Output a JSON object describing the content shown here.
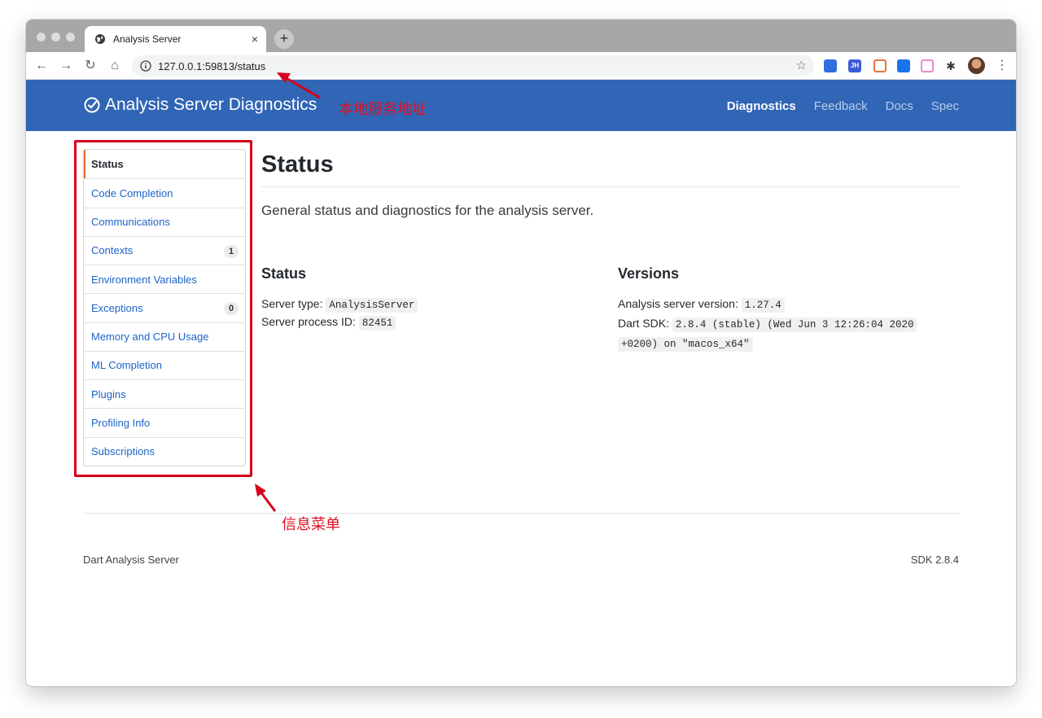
{
  "browser": {
    "tab_title": "Analysis Server",
    "tab_close": "×",
    "new_tab": "+",
    "address": "127.0.0.1:59813/status",
    "extensions_badge": "JH"
  },
  "header": {
    "title": "Analysis Server Diagnostics",
    "nav": [
      "Diagnostics",
      "Feedback",
      "Docs",
      "Spec"
    ],
    "active_nav": "Diagnostics"
  },
  "sidebar": {
    "items": [
      {
        "label": "Status",
        "active": true
      },
      {
        "label": "Code Completion"
      },
      {
        "label": "Communications"
      },
      {
        "label": "Contexts",
        "count": "1"
      },
      {
        "label": "Environment Variables"
      },
      {
        "label": "Exceptions",
        "count": "0"
      },
      {
        "label": "Memory and CPU Usage"
      },
      {
        "label": "ML Completion"
      },
      {
        "label": "Plugins"
      },
      {
        "label": "Profiling Info"
      },
      {
        "label": "Subscriptions"
      }
    ]
  },
  "main": {
    "title": "Status",
    "description": "General status and diagnostics for the analysis server.",
    "status": {
      "heading": "Status",
      "server_type_label": "Server type:",
      "server_type": "AnalysisServer",
      "pid_label": "Server process ID:",
      "pid": "82451"
    },
    "versions": {
      "heading": "Versions",
      "server_version_label": "Analysis server version:",
      "server_version": "1.27.4",
      "sdk_label": "Dart SDK:",
      "sdk_line1": "2.8.4 (stable) (Wed Jun 3 12:26:04 2020",
      "sdk_line2": "+0200) on \"macos_x64\""
    }
  },
  "footer": {
    "left": "Dart Analysis Server",
    "right": "SDK 2.8.4"
  },
  "annotations": {
    "address_note": "本地服务地址",
    "menu_note": "信息菜单",
    "color": "#e0101f"
  },
  "colors": {
    "header_bg": "#3165b5",
    "link": "#1d63c8",
    "active_marker": "#e26b2e"
  }
}
